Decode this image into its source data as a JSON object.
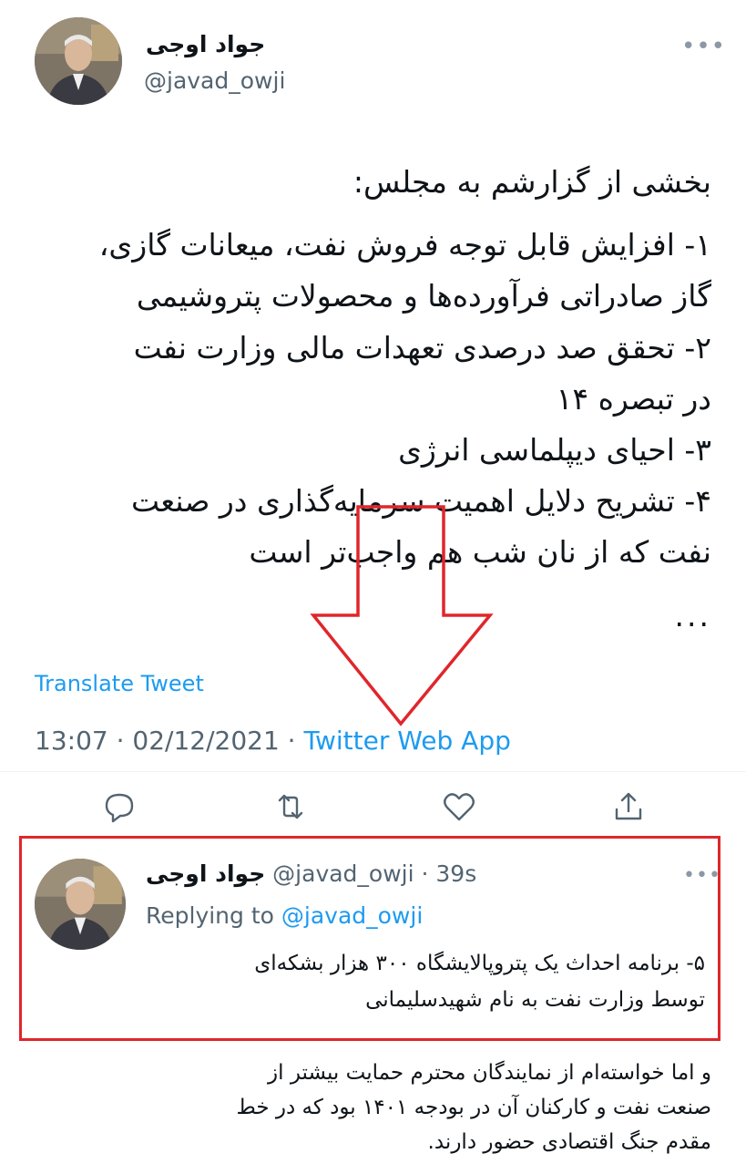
{
  "main_tweet": {
    "author_name": "جواد اوجی",
    "author_handle": "@javad_owji",
    "more": "•••",
    "lines": [
      "بخشی از گزارشم به مجلس:",
      "۱- افزایش قابل توجه فروش نفت، میعانات گازی،",
      "گاز صادراتی  فرآورده‌ها و محصولات پتروشیمی",
      "۲- تحقق صد درصدی تعهدات مالی وزارت نفت",
      "در تبصره ۱۴",
      "۳- احیای دیپلماسی انرژی",
      "۴- تشریح دلایل اهمیت سرمایه‌گذاری در صنعت",
      "نفت که از نان شب هم واجب‌تر است",
      "..."
    ],
    "translate_label": "Translate Tweet",
    "timestamp": "13:07 · 02/12/2021 · ",
    "source_app": "Twitter Web App"
  },
  "actions": {
    "reply_icon": "reply-icon",
    "retweet_icon": "retweet-icon",
    "like_icon": "like-icon",
    "share_icon": "share-icon"
  },
  "reply_tweet": {
    "author_name": "جواد اوجی",
    "author_handle": "@javad_owji",
    "time": " · 39s",
    "more": "•••",
    "replying_to_label": "Replying to ",
    "replying_to_handle": "@javad_owji",
    "lines": [
      "۵- برنامه احداث یک پتروپالایشگاه ۳۰۰ هزار بشکه‌ای",
      "توسط وزارت نفت به نام شهیدسلیمانی"
    ]
  },
  "bottom_caption": {
    "lines": [
      "و اما خواسته‌ام از نمایندگان محترم حمایت بیشتر از",
      "صنعت نفت و کارکنان آن در بودجه ۱۴۰۱ بود که در خط",
      "مقدم جنگ اقتصادی حضور دارند."
    ]
  },
  "annotation": {
    "highlight_color": "#e0262b",
    "arrow_color": "#e0262b"
  }
}
